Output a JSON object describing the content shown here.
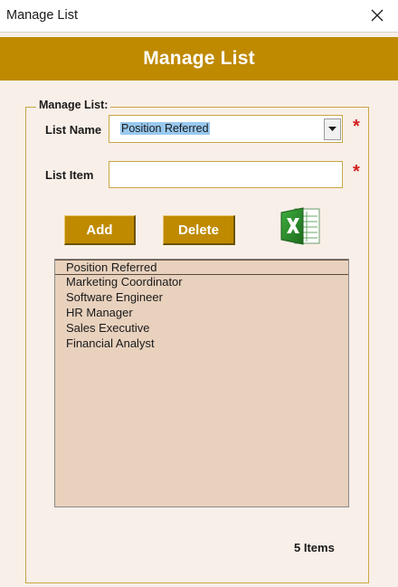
{
  "window": {
    "title": "Manage List",
    "close_icon": "close-icon"
  },
  "banner": {
    "title": "Manage List",
    "background": "#bf8a00"
  },
  "form": {
    "group_label": "Manage List:",
    "list_name_label": "List Name",
    "list_name_value": "Position Referred",
    "list_item_label": "List Item",
    "list_item_value": "",
    "required_marker": "*",
    "add_label": "Add",
    "delete_label": "Delete",
    "export_icon": "excel-icon"
  },
  "list": {
    "items": [
      "Position Referred",
      "Marketing Coordinator",
      "Software Engineer",
      "HR Manager",
      "Sales Executive",
      "Financial Analyst"
    ]
  },
  "footer": {
    "count_text": "5 Items"
  },
  "colors": {
    "accent": "#bf8a00",
    "form_background": "#f8efe8",
    "list_background": "#e8d1bd",
    "required": "#d22020"
  }
}
